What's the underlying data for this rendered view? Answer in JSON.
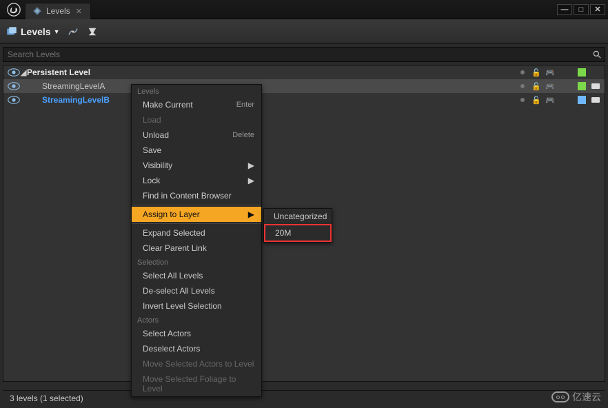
{
  "window": {
    "tab_title": "Levels"
  },
  "toolbar": {
    "levels_label": "Levels"
  },
  "search": {
    "placeholder": "Search Levels"
  },
  "tree": {
    "persistent": "Persistent Level",
    "levelA": "StreamingLevelA",
    "levelB": "StreamingLevelB"
  },
  "context_menu": {
    "section_levels": "Levels",
    "make_current": "Make Current",
    "make_current_shortcut": "Enter",
    "load": "Load",
    "unload": "Unload",
    "unload_shortcut": "Delete",
    "save": "Save",
    "visibility": "Visibility",
    "lock": "Lock",
    "find_in_cb": "Find in Content Browser",
    "assign_to_layer": "Assign to Layer",
    "expand_selected": "Expand Selected",
    "clear_parent": "Clear Parent Link",
    "section_selection": "Selection",
    "select_all": "Select All Levels",
    "deselect_all": "De-select All Levels",
    "invert": "Invert Level Selection",
    "section_actors": "Actors",
    "select_actors": "Select Actors",
    "deselect_actors": "Deselect Actors",
    "move_actors": "Move Selected Actors to Level",
    "move_foliage": "Move Selected Foliage to Level",
    "submenu": {
      "uncategorized": "Uncategorized",
      "twenty_m": "20M"
    }
  },
  "status": {
    "text": "3 levels (1 selected)"
  },
  "watermark": "亿速云"
}
